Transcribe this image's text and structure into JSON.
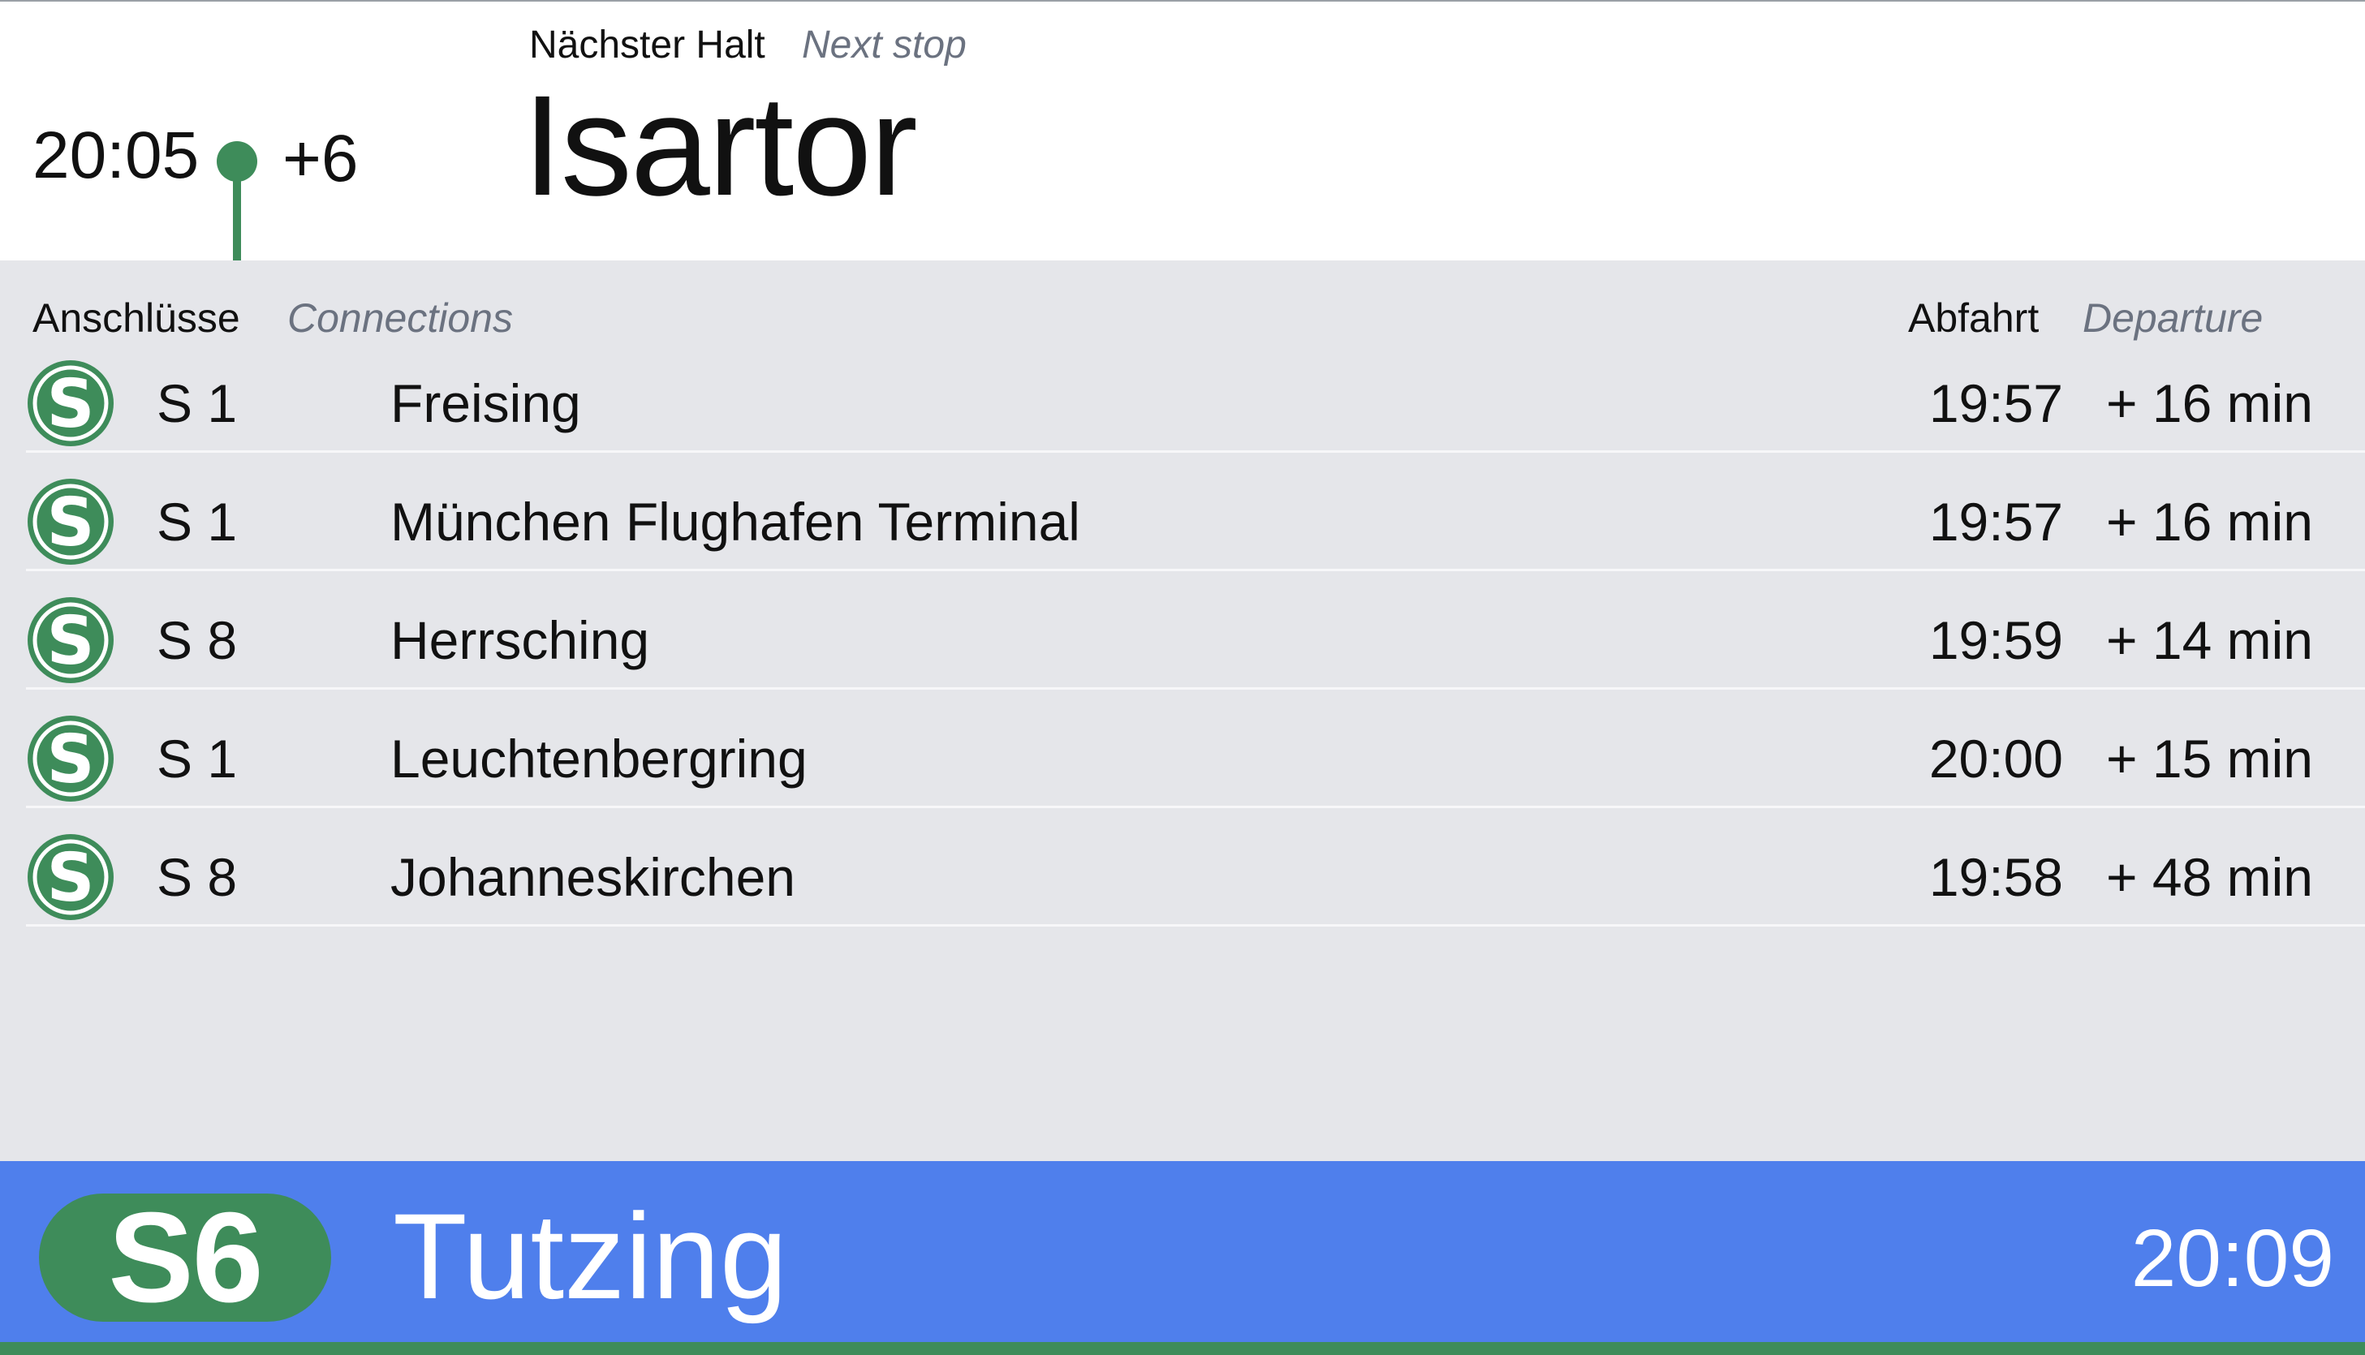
{
  "colors": {
    "accent_green": "#3e8c5a",
    "footer_blue": "#4f7fec",
    "panel_gray": "#e5e6ea",
    "muted_text": "#6b7280"
  },
  "header": {
    "current_time": "20:05",
    "delay": "+6",
    "next_stop_label": "Nächster Halt",
    "next_stop_label_en": "Next stop",
    "next_stop_name": "Isartor"
  },
  "connections": {
    "title": "Anschlüsse",
    "title_en": "Connections",
    "departure_label": "Abfahrt",
    "departure_label_en": "Departure",
    "rows": [
      {
        "icon": "s-bahn-icon",
        "line": "S 1",
        "destination": "Freising",
        "departure": "19:57",
        "wait": "+ 16 min"
      },
      {
        "icon": "s-bahn-icon",
        "line": "S 1",
        "destination": "München Flughafen Terminal",
        "departure": "19:57",
        "wait": "+ 16 min"
      },
      {
        "icon": "s-bahn-icon",
        "line": "S 8",
        "destination": "Herrsching",
        "departure": "19:59",
        "wait": "+ 14 min"
      },
      {
        "icon": "s-bahn-icon",
        "line": "S 1",
        "destination": "Leuchtenbergring",
        "departure": "20:00",
        "wait": "+ 15 min"
      },
      {
        "icon": "s-bahn-icon",
        "line": "S 8",
        "destination": "Johanneskirchen",
        "departure": "19:58",
        "wait": "+ 48 min"
      }
    ]
  },
  "footer": {
    "line": "S6",
    "destination": "Tutzing",
    "arrival_time": "20:09"
  }
}
